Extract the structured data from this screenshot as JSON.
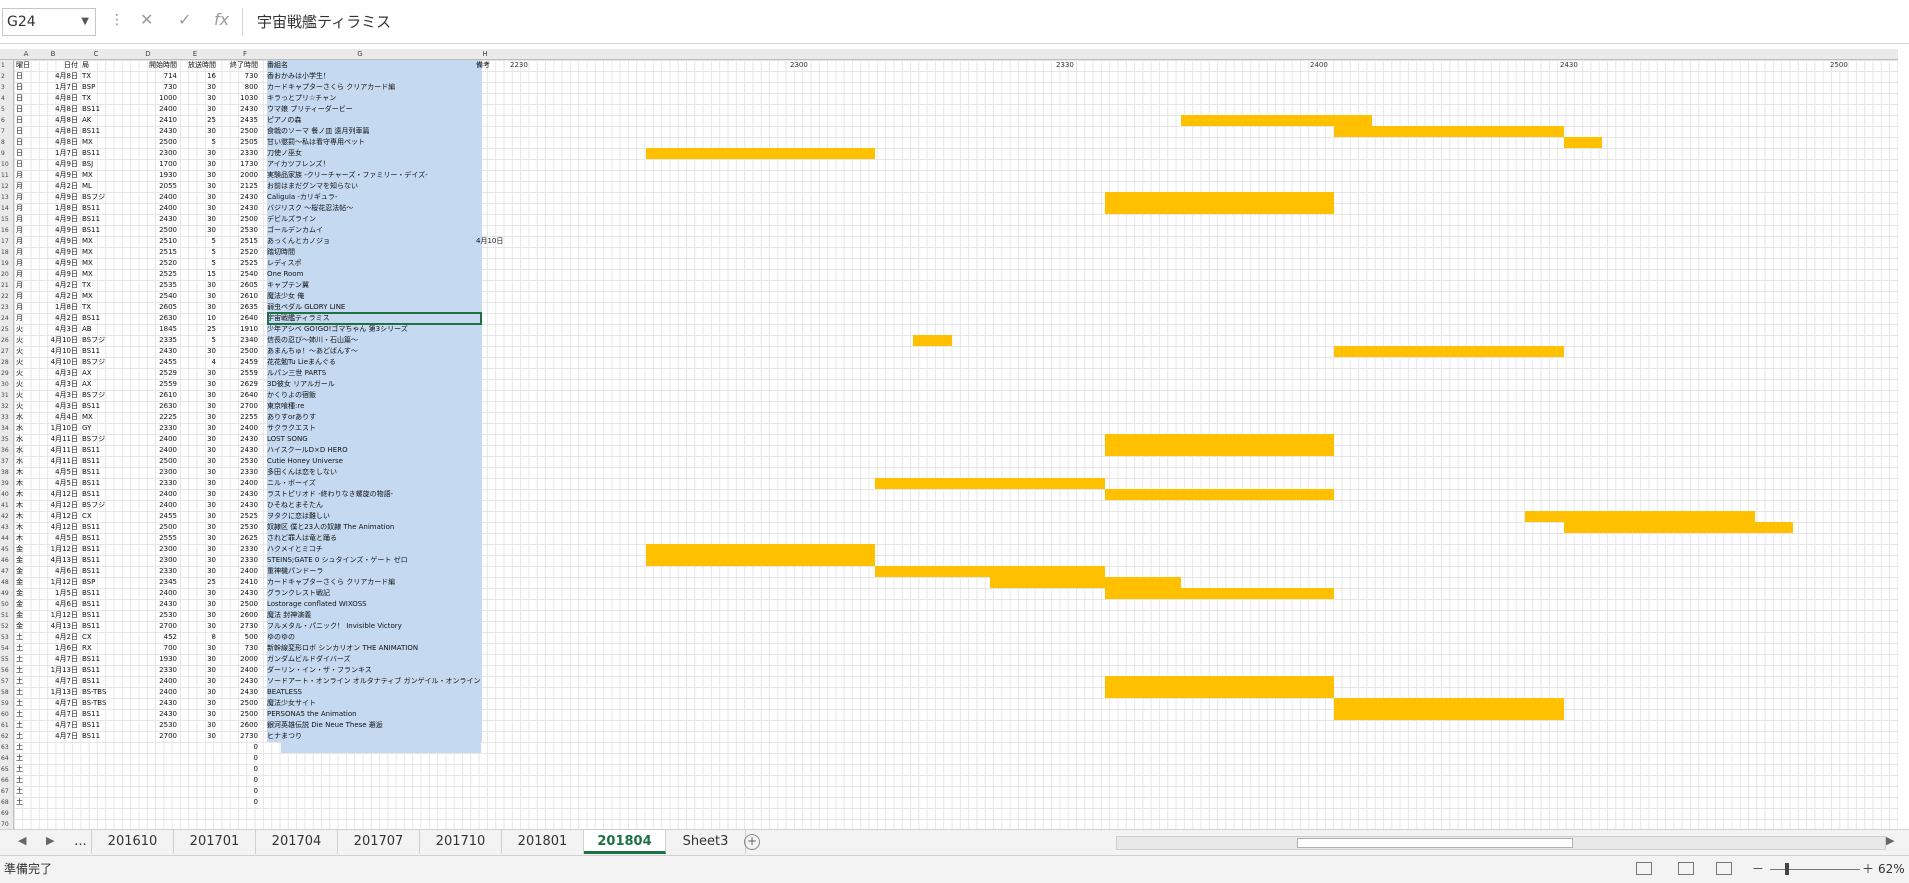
{
  "formula_bar": {
    "name_box": "G24",
    "cancel_icon": "✕",
    "confirm_icon": "✓",
    "function_icon": "fx",
    "value": "宇宙戦艦ティラミス"
  },
  "columns": [
    "A",
    "B",
    "C",
    "D",
    "E",
    "F",
    "G",
    "H"
  ],
  "header_row": {
    "a": "曜日",
    "b": "日付",
    "c": "局",
    "d": "開始時間",
    "e": "放送時間",
    "f": "終了時間",
    "g": "番組名",
    "h": "備考"
  },
  "time_ticks": [
    "2230",
    "2300",
    "2330",
    "2400",
    "2430",
    "2500"
  ],
  "rows": [
    {
      "a": "日",
      "b": "4月8日",
      "c": "TX",
      "d": "714",
      "e": "16",
      "f": "730",
      "g": "香おかみは小学生！"
    },
    {
      "a": "日",
      "b": "1月7日",
      "c": "BSP",
      "d": "730",
      "e": "30",
      "f": "800",
      "g": "カードキャプターさくら クリアカード編"
    },
    {
      "a": "日",
      "b": "4月8日",
      "c": "TX",
      "d": "1000",
      "e": "30",
      "f": "1030",
      "g": "キラっとプリ☆チャン"
    },
    {
      "a": "日",
      "b": "4月8日",
      "c": "BS11",
      "d": "2400",
      "e": "30",
      "f": "2430",
      "g": "ウマ娘 プリティーダービー"
    },
    {
      "a": "日",
      "b": "4月8日",
      "c": "AK",
      "d": "2410",
      "e": "25",
      "f": "2435",
      "g": "ピアノの森"
    },
    {
      "a": "日",
      "b": "4月8日",
      "c": "BS11",
      "d": "2430",
      "e": "30",
      "f": "2500",
      "g": "食戟のソーマ 餐ノ皿 遠月列車篇"
    },
    {
      "a": "日",
      "b": "4月8日",
      "c": "MX",
      "d": "2500",
      "e": "5",
      "f": "2505",
      "g": "甘い懲罰～私は看守専用ペット"
    },
    {
      "a": "日",
      "b": "1月7日",
      "c": "BS11",
      "d": "2300",
      "e": "30",
      "f": "2330",
      "g": "刀使ノ巫女"
    },
    {
      "a": "日",
      "b": "4月9日",
      "c": "BSJ",
      "d": "1700",
      "e": "30",
      "f": "1730",
      "g": "アイカツフレンズ！"
    },
    {
      "a": "月",
      "b": "4月9日",
      "c": "MX",
      "d": "1930",
      "e": "30",
      "f": "2000",
      "g": "実験品家族 -クリーチャーズ・ファミリー・デイズ-"
    },
    {
      "a": "月",
      "b": "4月2日",
      "c": "ML",
      "d": "2055",
      "e": "30",
      "f": "2125",
      "g": "お前はまだグンマを知らない"
    },
    {
      "a": "月",
      "b": "4月9日",
      "c": "BSフジ",
      "d": "2400",
      "e": "30",
      "f": "2430",
      "g": "Caligula -カリギュラ-"
    },
    {
      "a": "月",
      "b": "1月8日",
      "c": "BS11",
      "d": "2400",
      "e": "30",
      "f": "2430",
      "g": "バジリスク ～桜花忍法帖～"
    },
    {
      "a": "月",
      "b": "4月9日",
      "c": "BS11",
      "d": "2430",
      "e": "30",
      "f": "2500",
      "g": "デビルズライン"
    },
    {
      "a": "月",
      "b": "4月9日",
      "c": "BS11",
      "d": "2500",
      "e": "30",
      "f": "2530",
      "g": "ゴールデンカムイ"
    },
    {
      "a": "月",
      "b": "4月9日",
      "c": "MX",
      "d": "2510",
      "e": "5",
      "f": "2515",
      "g": "あっくんとカノジョ",
      "h": "4月10日"
    },
    {
      "a": "月",
      "b": "4月9日",
      "c": "MX",
      "d": "2515",
      "e": "5",
      "f": "2520",
      "g": "踏切時間"
    },
    {
      "a": "月",
      "b": "4月9日",
      "c": "MX",
      "d": "2520",
      "e": "5",
      "f": "2525",
      "g": "レディスポ"
    },
    {
      "a": "月",
      "b": "4月9日",
      "c": "MX",
      "d": "2525",
      "e": "15",
      "f": "2540",
      "g": "One Room"
    },
    {
      "a": "月",
      "b": "4月2日",
      "c": "TX",
      "d": "2535",
      "e": "30",
      "f": "2605",
      "g": "キャプテン翼"
    },
    {
      "a": "月",
      "b": "4月2日",
      "c": "MX",
      "d": "2540",
      "e": "30",
      "f": "2610",
      "g": "魔法少女 俺"
    },
    {
      "a": "月",
      "b": "1月8日",
      "c": "TX",
      "d": "2605",
      "e": "30",
      "f": "2635",
      "g": "弱虫ペダル GLORY LINE"
    },
    {
      "a": "月",
      "b": "4月2日",
      "c": "BS11",
      "d": "2630",
      "e": "10",
      "f": "2640",
      "g": "宇宙戦艦ティラミス"
    },
    {
      "a": "火",
      "b": "4月3日",
      "c": "AB",
      "d": "1845",
      "e": "25",
      "f": "1910",
      "g": "少年アシベ GO!GO!ゴマちゃん 第3シリーズ"
    },
    {
      "a": "火",
      "b": "4月10日",
      "c": "BSフジ",
      "d": "2335",
      "e": "5",
      "f": "2340",
      "g": "信長の忍び～姉川・石山篇～"
    },
    {
      "a": "火",
      "b": "4月10日",
      "c": "BS11",
      "d": "2430",
      "e": "30",
      "f": "2500",
      "g": "あまんちゅ！～あどばんす～"
    },
    {
      "a": "火",
      "b": "4月10日",
      "c": "BSフジ",
      "d": "2455",
      "e": "4",
      "f": "2459",
      "g": "花花勉Tu Lieまんぐる"
    },
    {
      "a": "火",
      "b": "4月3日",
      "c": "AX",
      "d": "2529",
      "e": "30",
      "f": "2559",
      "g": "ルパン三世 PARTS"
    },
    {
      "a": "火",
      "b": "4月3日",
      "c": "AX",
      "d": "2559",
      "e": "30",
      "f": "2629",
      "g": "3D彼女 リアルガール"
    },
    {
      "a": "火",
      "b": "4月3日",
      "c": "BSフジ",
      "d": "2610",
      "e": "30",
      "f": "2640",
      "g": "かくりよの宿飯"
    },
    {
      "a": "火",
      "b": "4月3日",
      "c": "BS11",
      "d": "2630",
      "e": "30",
      "f": "2700",
      "g": "東京喰種:re"
    },
    {
      "a": "水",
      "b": "4月4日",
      "c": "MX",
      "d": "2225",
      "e": "30",
      "f": "2255",
      "g": "ありすorありす"
    },
    {
      "a": "水",
      "b": "1月10日",
      "c": "GY",
      "d": "2330",
      "e": "30",
      "f": "2400",
      "g": "サクラクエスト"
    },
    {
      "a": "水",
      "b": "4月11日",
      "c": "BSフジ",
      "d": "2400",
      "e": "30",
      "f": "2430",
      "g": "LOST SONG"
    },
    {
      "a": "水",
      "b": "4月11日",
      "c": "BS11",
      "d": "2400",
      "e": "30",
      "f": "2430",
      "g": "ハイスクールD×D HERO"
    },
    {
      "a": "水",
      "b": "4月11日",
      "c": "BS11",
      "d": "2500",
      "e": "30",
      "f": "2530",
      "g": "Cutie Honey Universe"
    },
    {
      "a": "木",
      "b": "4月5日",
      "c": "BS11",
      "d": "2300",
      "e": "30",
      "f": "2330",
      "g": "多田くんは恋をしない"
    },
    {
      "a": "木",
      "b": "4月5日",
      "c": "BS11",
      "d": "2330",
      "e": "30",
      "f": "2400",
      "g": "ニル・ボーイズ"
    },
    {
      "a": "木",
      "b": "4月12日",
      "c": "BS11",
      "d": "2400",
      "e": "30",
      "f": "2430",
      "g": "ラストピリオド -終わりなき螺旋の物語-"
    },
    {
      "a": "木",
      "b": "4月12日",
      "c": "BSフジ",
      "d": "2400",
      "e": "30",
      "f": "2430",
      "g": "ひそねとまそたん"
    },
    {
      "a": "木",
      "b": "4月12日",
      "c": "CX",
      "d": "2455",
      "e": "30",
      "f": "2525",
      "g": "ヲタクに恋は難しい"
    },
    {
      "a": "木",
      "b": "4月12日",
      "c": "BS11",
      "d": "2500",
      "e": "30",
      "f": "2530",
      "g": "奴隷区 僕と23人の奴隷 The Animation"
    },
    {
      "a": "木",
      "b": "4月5日",
      "c": "BS11",
      "d": "2555",
      "e": "30",
      "f": "2625",
      "g": "されど罪人は竜と踊る"
    },
    {
      "a": "金",
      "b": "1月12日",
      "c": "BS11",
      "d": "2300",
      "e": "30",
      "f": "2330",
      "g": "ハクメイとミコチ"
    },
    {
      "a": "金",
      "b": "4月13日",
      "c": "BS11",
      "d": "2300",
      "e": "30",
      "f": "2330",
      "g": "STEINS;GATE 0 シュタインズ・ゲート ゼロ"
    },
    {
      "a": "金",
      "b": "4月6日",
      "c": "BS11",
      "d": "2330",
      "e": "30",
      "f": "2400",
      "g": "重神機パンドーラ"
    },
    {
      "a": "金",
      "b": "1月12日",
      "c": "BSP",
      "d": "2345",
      "e": "25",
      "f": "2410",
      "g": "カードキャプターさくら クリアカード編"
    },
    {
      "a": "金",
      "b": "1月5日",
      "c": "BS11",
      "d": "2400",
      "e": "30",
      "f": "2430",
      "g": "グランクレスト戦記"
    },
    {
      "a": "金",
      "b": "4月6日",
      "c": "BS11",
      "d": "2430",
      "e": "30",
      "f": "2500",
      "g": "Lostorage conflated WIXOSS"
    },
    {
      "a": "金",
      "b": "1月12日",
      "c": "BS11",
      "d": "2530",
      "e": "30",
      "f": "2600",
      "g": "魔法 封神演義"
    },
    {
      "a": "金",
      "b": "4月13日",
      "c": "BS11",
      "d": "2700",
      "e": "30",
      "f": "2730",
      "g": "フルメタル・パニック！ Invisible Victory"
    },
    {
      "a": "土",
      "b": "4月2日",
      "c": "CX",
      "d": "452",
      "e": "8",
      "f": "500",
      "g": "ゆのゆの"
    },
    {
      "a": "土",
      "b": "1月6日",
      "c": "RX",
      "d": "700",
      "e": "30",
      "f": "730",
      "g": "新幹線変形ロボ シンカリオン THE ANIMATION"
    },
    {
      "a": "土",
      "b": "4月7日",
      "c": "BS11",
      "d": "1930",
      "e": "30",
      "f": "2000",
      "g": "ガンダムビルドダイバーズ"
    },
    {
      "a": "土",
      "b": "1月13日",
      "c": "BS11",
      "d": "2330",
      "e": "30",
      "f": "2400",
      "g": "ダーリン・イン・ザ・フランキス"
    },
    {
      "a": "土",
      "b": "4月7日",
      "c": "BS11",
      "d": "2400",
      "e": "30",
      "f": "2430",
      "g": "ソードアート・オンライン オルタナティブ ガンゲイル・オンライン"
    },
    {
      "a": "土",
      "b": "1月13日",
      "c": "BS-TBS",
      "d": "2400",
      "e": "30",
      "f": "2430",
      "g": "BEATLESS"
    },
    {
      "a": "土",
      "b": "4月7日",
      "c": "BS-TBS",
      "d": "2430",
      "e": "30",
      "f": "2500",
      "g": "魔法少女サイト"
    },
    {
      "a": "土",
      "b": "4月7日",
      "c": "BS11",
      "d": "2430",
      "e": "30",
      "f": "2500",
      "g": "PERSONA5 the Animation"
    },
    {
      "a": "土",
      "b": "4月7日",
      "c": "BS11",
      "d": "2530",
      "e": "30",
      "f": "2600",
      "g": "銀河英雄伝説 Die Neue These 邂逅"
    },
    {
      "a": "土",
      "b": "4月7日",
      "c": "BS11",
      "d": "2700",
      "e": "30",
      "f": "2730",
      "g": "ヒナまつり"
    },
    {
      "a": "土",
      "f": "0"
    },
    {
      "a": "土",
      "f": "0"
    },
    {
      "a": "土",
      "f": "0"
    },
    {
      "a": "土",
      "f": "0"
    },
    {
      "a": "土",
      "f": "0"
    },
    {
      "a": "土",
      "f": "0"
    }
  ],
  "sheet_tabs": [
    "...",
    "201610",
    "201701",
    "201704",
    "201707",
    "201710",
    "201801",
    "201804",
    "Sheet3"
  ],
  "active_tab": "201804",
  "status": {
    "ready": "準備完了",
    "zoom": "62%"
  },
  "colors": {
    "highlight": "#ffc000",
    "title_fill": "#c5d9f1",
    "accent": "#1e7145"
  }
}
